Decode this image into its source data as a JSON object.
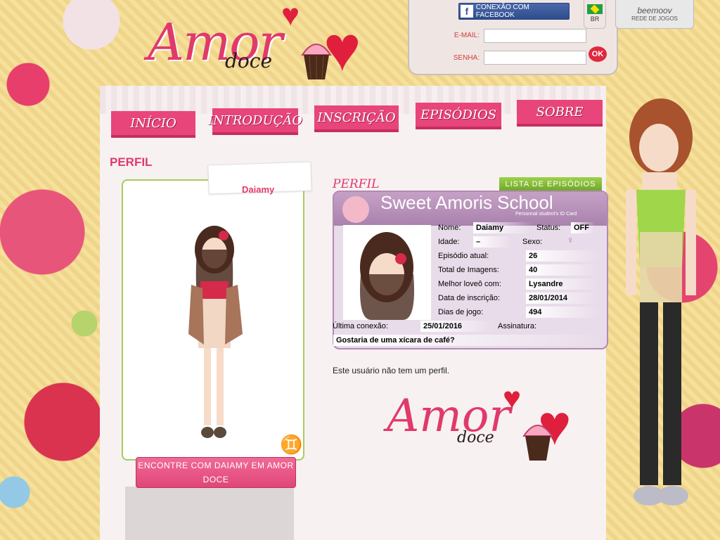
{
  "logo": {
    "amor": "Amor",
    "doce": "doce"
  },
  "login": {
    "facebook_label": "CONEXÃO COM FACEBOOK",
    "email_label": "E-MAIL:",
    "password_label": "SENHA:",
    "ok_label": "OK",
    "email_value": "",
    "password_value": ""
  },
  "language": {
    "code": "BR"
  },
  "network": {
    "logo": "beemoov",
    "label": "REDE DE JOGOS"
  },
  "nav": {
    "items": [
      {
        "label": "INÍCIO"
      },
      {
        "label": "INTRODUÇÃO"
      },
      {
        "label": "INSCRIÇÃO"
      },
      {
        "label": "EPISÓDIOS"
      },
      {
        "label": "SOBRE"
      }
    ]
  },
  "page": {
    "title": "PERFIL"
  },
  "avatar": {
    "name": "Daiamy",
    "zodiac_icon": "gemini-icon",
    "find_button": "ENCONTRE COM DAIAMY EM AMOR DOCE"
  },
  "profile": {
    "section_label": "PERFIL",
    "episodes_button": "LISTA DE EPISÓDIOS",
    "card_title": "Sweet Amoris School",
    "card_subtitle": "Personnal student's ID Card",
    "fields": {
      "nome_label": "Nome:",
      "nome": "Daiamy",
      "status_label": "Status:",
      "status": "OFF",
      "idade_label": "Idade:",
      "idade": "–",
      "sexo_label": "Sexo:",
      "sexo_icon": "female-symbol-icon",
      "episodio_label": "Episódio atual:",
      "episodio": "26",
      "imagens_label": "Total de Imagens:",
      "imagens": "40",
      "love_label": "Melhor loveô com:",
      "love": "Lysandre",
      "inscricao_label": "Data de inscrição:",
      "inscricao": "28/01/2014",
      "dias_label": "Dias de jogo:",
      "dias": "494",
      "conexao_label": "Última conexão:",
      "conexao": "25/01/2016",
      "assinatura_label": "Assinatura:",
      "quote": "Gostaria de uma xícara de café?"
    },
    "no_profile_text": "Este usuário não tem um perfil."
  },
  "colors": {
    "accent": "#e03a6a",
    "nav": "#e8457a",
    "card": "#a982ad",
    "green": "#8cc63f"
  }
}
